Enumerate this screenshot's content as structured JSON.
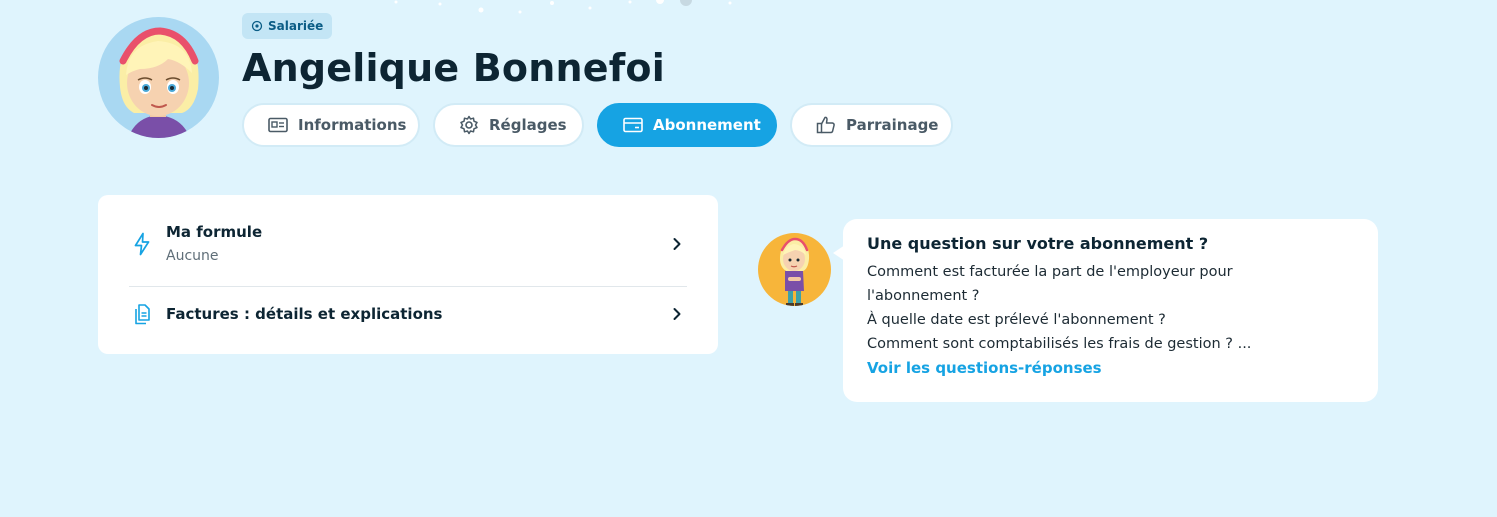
{
  "profile": {
    "badge_label": "Salariée",
    "name": "Angelique Bonnefoi"
  },
  "tabs": [
    {
      "label": "Informations",
      "icon": "id-card-icon",
      "active": false
    },
    {
      "label": "Réglages",
      "icon": "gear-icon",
      "active": false
    },
    {
      "label": "Abonnement",
      "icon": "credit-card-icon",
      "active": true
    },
    {
      "label": "Parrainage",
      "icon": "thumbs-up-icon",
      "active": false
    }
  ],
  "subscription": {
    "formula": {
      "title": "Ma formule",
      "value": "Aucune",
      "icon": "lightning-icon"
    },
    "invoices": {
      "title": "Factures : détails et explications",
      "icon": "documents-icon"
    }
  },
  "faq": {
    "title": "Une question sur votre abonnement ?",
    "lines": [
      "Comment est facturée la part de l'employeur pour",
      "l'abonnement ?",
      "À quelle date est prélevé l'abonnement ?",
      "Comment sont comptabilisés les frais de gestion ? ..."
    ],
    "link": "Voir les questions-réponses"
  },
  "colors": {
    "background": "#dff4fd",
    "accent": "#16a3e3",
    "text": "#0d2533"
  }
}
